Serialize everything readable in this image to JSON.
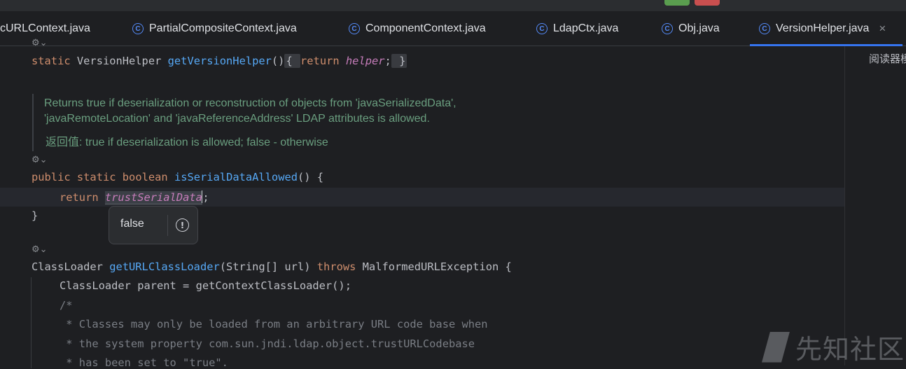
{
  "tabs": [
    {
      "label": "cURLContext.java",
      "active": false
    },
    {
      "label": "PartialCompositeContext.java",
      "active": false
    },
    {
      "label": "ComponentContext.java",
      "active": false
    },
    {
      "label": "LdapCtx.java",
      "active": false
    },
    {
      "label": "Obj.java",
      "active": false
    },
    {
      "label": "VersionHelper.java",
      "active": true
    }
  ],
  "tab_close_glyph": "×",
  "tab_icon_letter": "C",
  "right_panel": {
    "reader_mode": "阅读器模式"
  },
  "gutter_marker": "⚙⌄",
  "code": {
    "line1": {
      "kw": "static",
      "type": "VersionHelper",
      "fn": "getVersionHelper",
      "parens": "()",
      "fold_open": "{",
      "kw_return": "return",
      "field": "helper",
      "semi": ";",
      "fold_close": "}"
    },
    "doc": {
      "line1": "Returns true if deserialization or reconstruction of objects from 'javaSerializedData',",
      "line2": "'javaRemoteLocation' and 'javaReferenceAddress' LDAP attributes is allowed.",
      "line3": "返回值: true if deserialization is allowed; false - otherwise"
    },
    "method2": {
      "kw1": "public",
      "kw2": "static",
      "kw3": "boolean",
      "fn": "isSerialDataAllowed",
      "rest": "() {"
    },
    "return_line": {
      "kw": "return",
      "field": "trustSerialData",
      "semi": ";"
    },
    "close_brace": "}",
    "method3": {
      "type": "ClassLoader",
      "fn": "getURLClassLoader",
      "params": "(String[] url)",
      "kw_throws": "throws",
      "exc": "MalformedURLException {"
    },
    "body1": "ClassLoader parent = getContextClassLoader();",
    "body2": "/*",
    "body3": " * Classes may only be loaded from an arbitrary URL code base when",
    "body4": " * the system property com.sun.jndi.ldap.object.trustURLCodebase",
    "body5": " * has been set to \"true\"."
  },
  "popup": {
    "value": "false",
    "icon": "!"
  },
  "watermark": {
    "text": "先知社区"
  }
}
